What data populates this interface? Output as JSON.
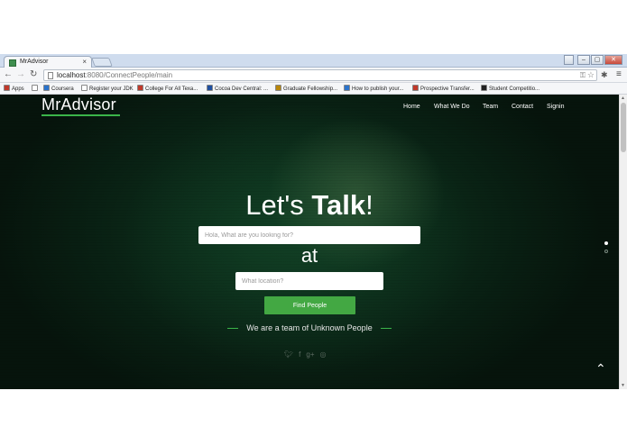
{
  "browser": {
    "tab_title": "MrAdvisor",
    "tab_close": "×",
    "url_host": "localhost",
    "url_path": ":8080/ConnectPeople/main",
    "menu_glyph": "≡"
  },
  "bookmarks": [
    {
      "label": "Apps",
      "icon": "apps-grid-icon",
      "color": "#c0392b"
    },
    {
      "label": "",
      "icon": "page-icon",
      "color": "#ffffff"
    },
    {
      "label": "Coursera",
      "icon": "coursera-icon",
      "color": "#2a73cc"
    },
    {
      "label": "Register your JDK",
      "icon": "page-icon",
      "color": "#ffffff"
    },
    {
      "label": "College For All Texa...",
      "icon": "star-icon",
      "color": "#c0392b"
    },
    {
      "label": "Cocoa Dev Central: ...",
      "icon": "cocoa-icon",
      "color": "#1f4fa0"
    },
    {
      "label": "Graduate Fellowship...",
      "icon": "fellowship-icon",
      "color": "#b8860b"
    },
    {
      "label": "How to publish your...",
      "icon": "globe-icon",
      "color": "#2a73cc"
    },
    {
      "label": "Prospective Transfer...",
      "icon": "shield-icon",
      "color": "#c0392b"
    },
    {
      "label": "Student Competitio...",
      "icon": "competition-icon",
      "color": "#222222"
    }
  ],
  "site": {
    "logo": "MrAdvisor",
    "nav": [
      "Home",
      "What We Do",
      "Team",
      "Contact",
      "Signin"
    ],
    "hero_prefix": "Let's ",
    "hero_bold": "Talk",
    "hero_suffix": "!",
    "search_placeholder": "Hola, What are you looking for?",
    "at_text": "at",
    "location_placeholder": "What location?",
    "find_button": "Find People",
    "tagline": "We are a team of Unknown People",
    "social_icons": [
      "twitter-icon",
      "facebook-icon",
      "google-plus-icon",
      "dribbble-icon"
    ]
  },
  "colors": {
    "accent_green": "#3bb54a",
    "button_green": "#43a843",
    "hero_background": "#0f3a22"
  }
}
